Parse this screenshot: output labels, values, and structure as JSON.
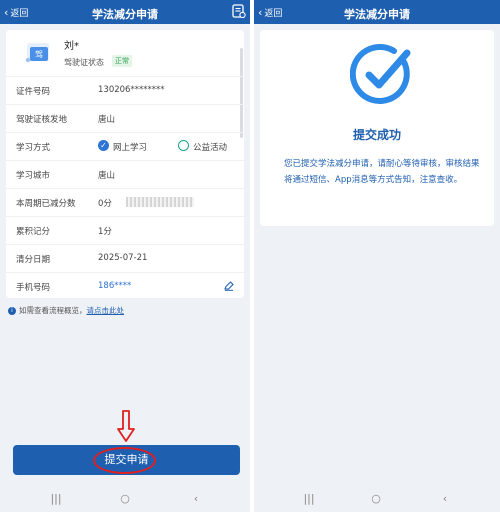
{
  "left": {
    "header": {
      "back_label": "返回",
      "title": "学法减分申请"
    },
    "profile": {
      "name": "刘*",
      "status_label": "驾驶证状态",
      "status_badge": "正常",
      "license_icon_text": "驾"
    },
    "rows": [
      {
        "label": "证件号码",
        "value": "130206********"
      },
      {
        "label": "驾驶证核发地",
        "value": "唐山"
      },
      {
        "label": "学习方式",
        "options": [
          {
            "label": "网上学习",
            "selected": true
          },
          {
            "label": "公益活动",
            "selected": false
          }
        ]
      },
      {
        "label": "学习城市",
        "value": "唐山"
      },
      {
        "label": "本周期已减分数",
        "value": "0分"
      },
      {
        "label": "累积记分",
        "value": "1分"
      },
      {
        "label": "清分日期",
        "value": "2025-07-21"
      },
      {
        "label": "手机号码",
        "value": "186****"
      }
    ],
    "info": {
      "text": "如需查看流程概览，",
      "link": "请点击此处"
    },
    "submit_label": "提交申请",
    "icons": [
      "chevron-left-icon",
      "document-icon",
      "license-icon",
      "check-icon",
      "info-icon",
      "edit-icon",
      "arrow-down-icon"
    ]
  },
  "right": {
    "header": {
      "back_label": "返回",
      "title": "学法减分申请"
    },
    "success_title": "提交成功",
    "success_message": "您已提交学法减分申请，请耐心等待审核，审核结果将通过短信、App消息等方式告知，注意查收。"
  },
  "navbar": {
    "recent": "|||",
    "home": "○",
    "back": "‹"
  },
  "colors": {
    "primary": "#1f5fb0",
    "badge_bg": "#e3f5e7",
    "badge_text": "#3aa05a",
    "annotation_red": "#e02020",
    "background": "#eef1f6"
  }
}
